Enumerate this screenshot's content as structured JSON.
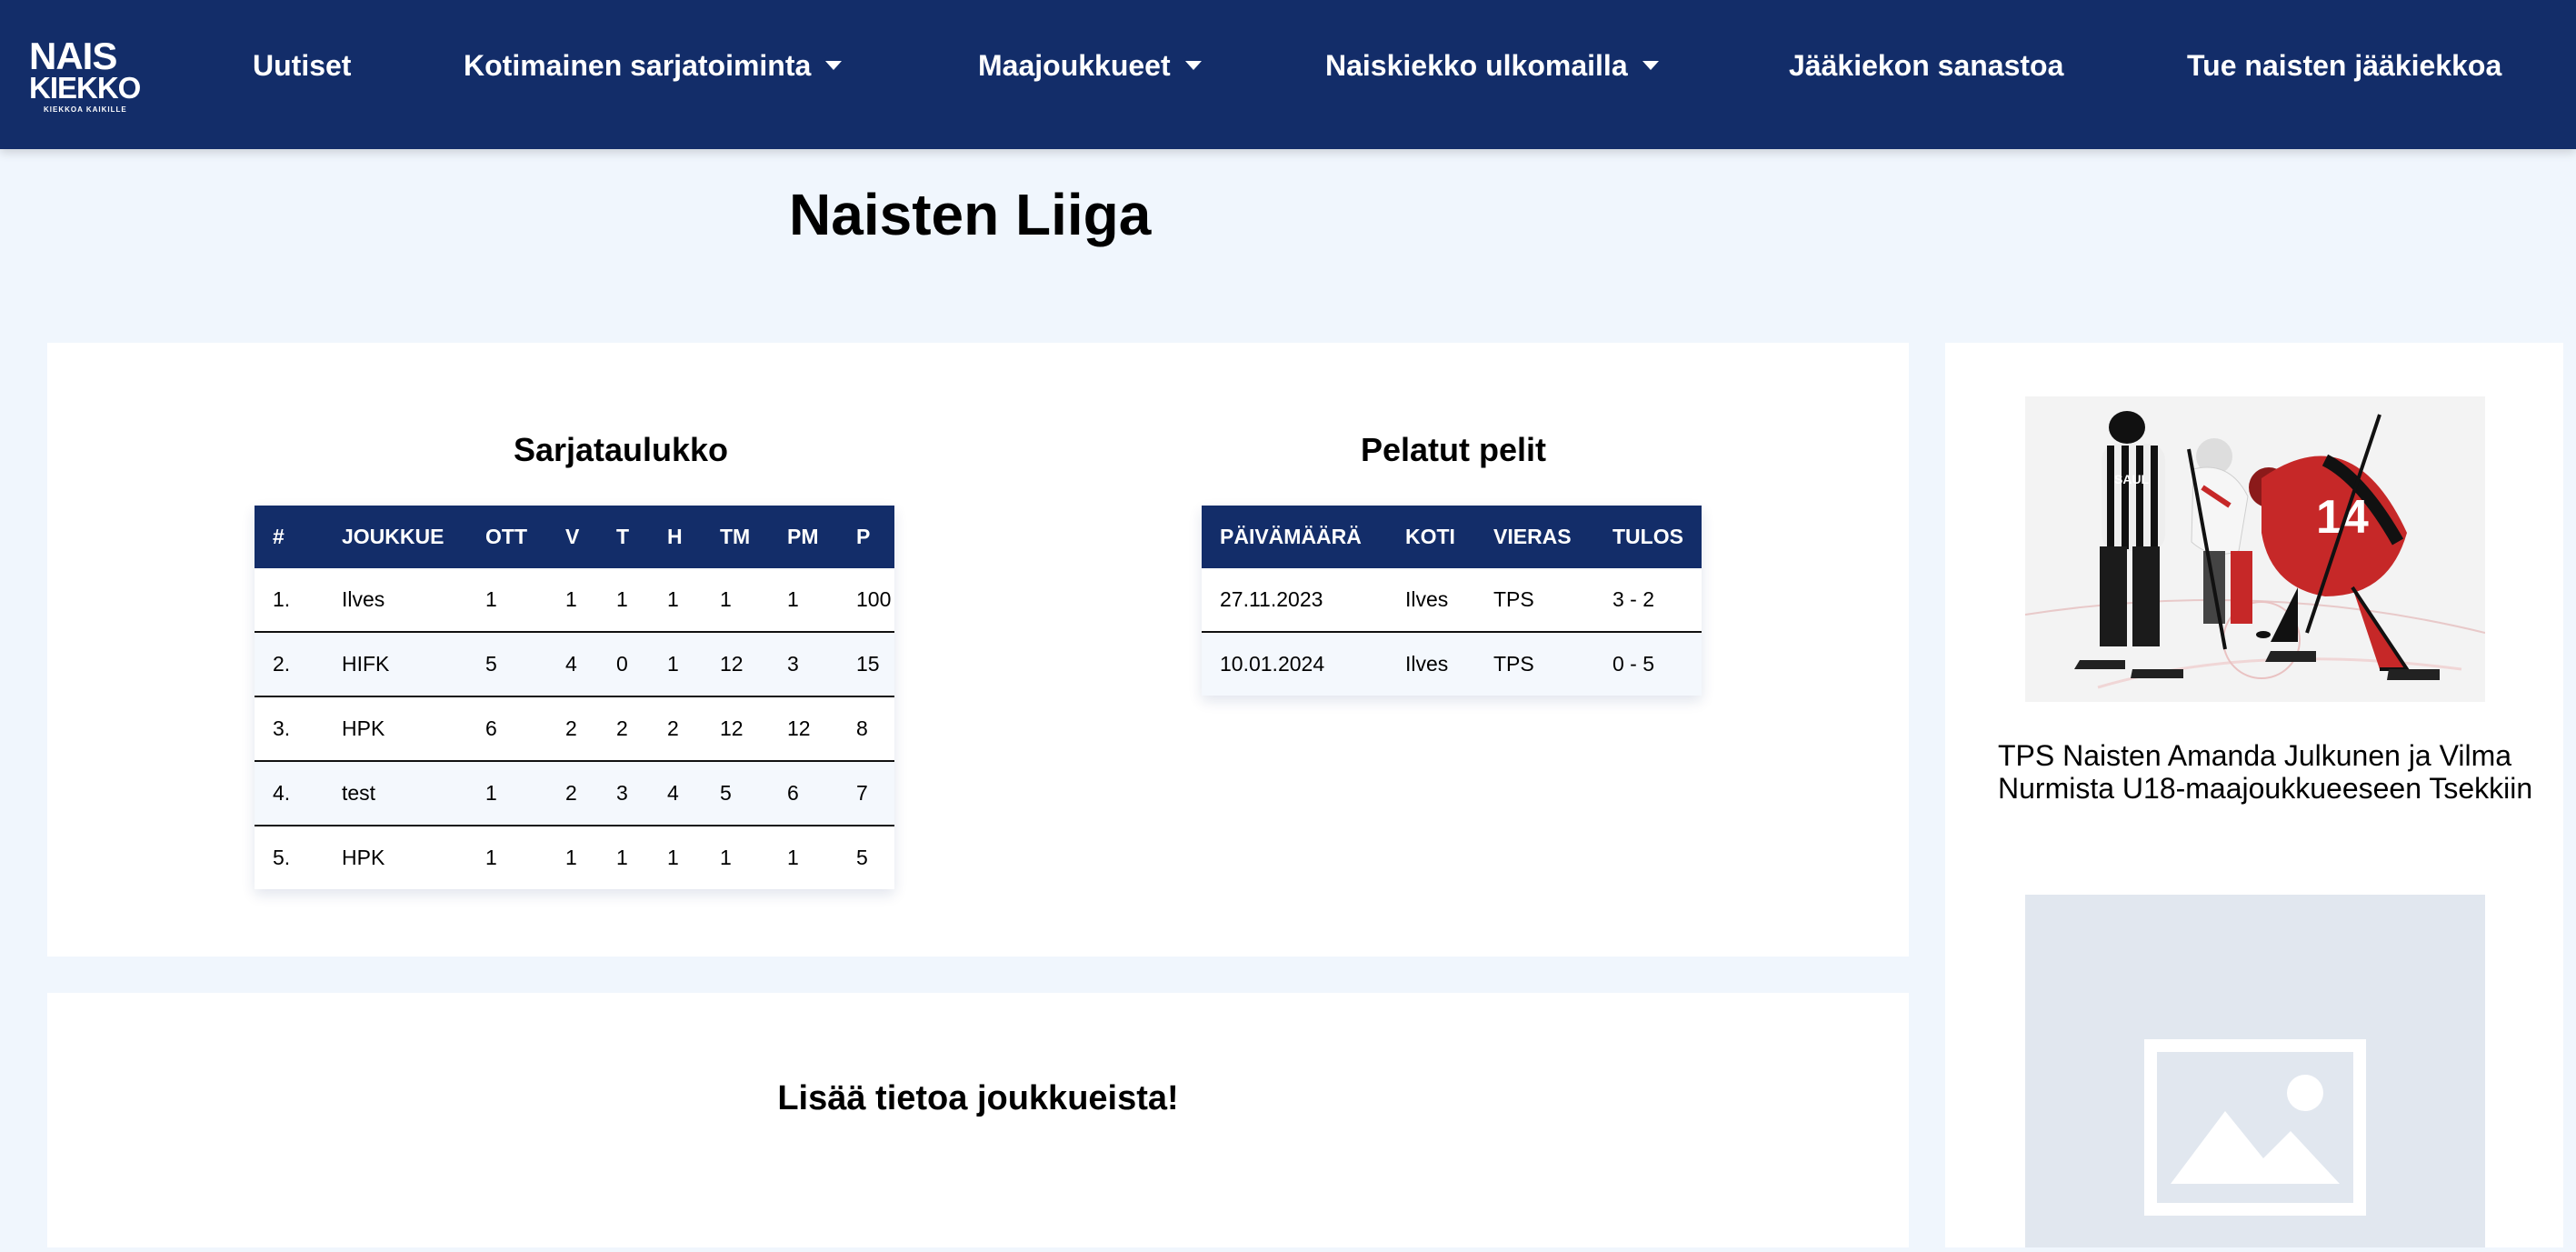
{
  "brand": {
    "line1": "NAIS",
    "line2": "KIEKKO",
    "tagline": "KIEKKOA KAIKILLE",
    "color": "#132d69"
  },
  "nav": {
    "items": [
      {
        "label": "Uutiset"
      },
      {
        "label": "Kotimainen sarjatoiminta"
      },
      {
        "label": "Maajoukkueet"
      },
      {
        "label": "Naiskiekko ulkomailla"
      },
      {
        "label": "Jääkiekon sanastoa"
      },
      {
        "label": "Tue naisten jääkiekkoa"
      }
    ]
  },
  "page": {
    "title": "Naisten Liiga"
  },
  "standings": {
    "title": "Sarjataulukko",
    "headers": [
      "#",
      "JOUKKUE",
      "OTT",
      "V",
      "T",
      "H",
      "TM",
      "PM",
      "P"
    ],
    "rows": [
      [
        "1.",
        "Ilves",
        "1",
        "1",
        "1",
        "1",
        "1",
        "1",
        "100"
      ],
      [
        "2.",
        "HIFK",
        "5",
        "4",
        "0",
        "1",
        "12",
        "3",
        "15"
      ],
      [
        "3.",
        "HPK",
        "6",
        "2",
        "2",
        "2",
        "12",
        "12",
        "8"
      ],
      [
        "4.",
        "test",
        "1",
        "2",
        "3",
        "4",
        "5",
        "6",
        "7"
      ],
      [
        "5.",
        "HPK",
        "1",
        "1",
        "1",
        "1",
        "1",
        "1",
        "5"
      ]
    ]
  },
  "games": {
    "title": "Pelatut pelit",
    "headers": [
      "PÄIVÄMÄÄRÄ",
      "KOTI",
      "VIERAS",
      "TULOS"
    ],
    "rows": [
      [
        "27.11.2023",
        "Ilves",
        "TPS",
        "3 - 2"
      ],
      [
        "10.01.2024",
        "Ilves",
        "TPS",
        "0 - 5"
      ]
    ]
  },
  "teams_section": {
    "title": "Lisää tietoa joukkueista!"
  },
  "sidebar": {
    "news": [
      {
        "title": "TPS Naisten Amanda Julkunen ja Vilma Nurmista U18-maajoukkueeseen Tsekkiin",
        "jersey_number": "14",
        "jersey_name": "SAUL"
      }
    ]
  }
}
